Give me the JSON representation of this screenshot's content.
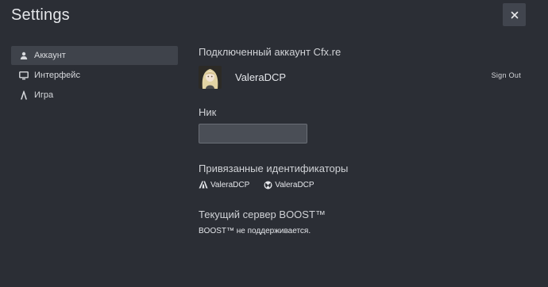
{
  "window": {
    "title": "Settings",
    "close_icon": "close-icon"
  },
  "colors": {
    "background": "#2b2e35",
    "active_item": "#3f434b",
    "input_bg": "#4a4e56",
    "close_bg": "#41454e"
  },
  "sidebar": {
    "items": [
      {
        "label": "Аккаунт",
        "icon": "user-icon",
        "active": true
      },
      {
        "label": "Интерфейс",
        "icon": "monitor-icon",
        "active": false
      },
      {
        "label": "Игра",
        "icon": "game-lambda-icon",
        "active": false
      }
    ]
  },
  "account": {
    "heading": "Подключенный аккаунт Cfx.re",
    "username": "ValeraDCP",
    "avatar_icon": "avatar-anime-girl",
    "sign_out_label": "Sign Out"
  },
  "nickname": {
    "label": "Ник",
    "value": "",
    "placeholder": ""
  },
  "identifiers": {
    "heading": "Привязанные идентификаторы",
    "items": [
      {
        "name": "ValeraDCP",
        "icon": "cfx-icon"
      },
      {
        "name": "ValeraDCP",
        "icon": "xbox-icon"
      }
    ]
  },
  "boost": {
    "heading": "Текущий сервер BOOST™",
    "status": "BOOST™ не поддерживается."
  }
}
